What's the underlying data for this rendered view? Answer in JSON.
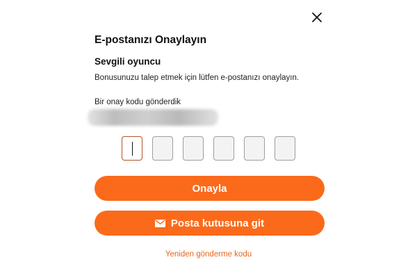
{
  "dialog": {
    "title": "E-postanızı Onaylayın",
    "greeting": "Sevgili oyuncu",
    "instruction": "Bonusunuzu talep etmek için lütfen e-postanızı onaylayın.",
    "sent_label": "Bir onay kodu gönderdik",
    "close_icon": "close-icon"
  },
  "code_input": {
    "digits": [
      "",
      "",
      "",
      "",
      "",
      ""
    ],
    "active_index": 0
  },
  "buttons": {
    "confirm_label": "Onayla",
    "inbox_label": "Posta kutusuna git",
    "inbox_icon": "envelope-icon"
  },
  "resend_label": "Yeniden gönderme kodu",
  "colors": {
    "accent": "#fb6a1a",
    "link": "#e8661c",
    "active_box_border": "#b0542a"
  }
}
